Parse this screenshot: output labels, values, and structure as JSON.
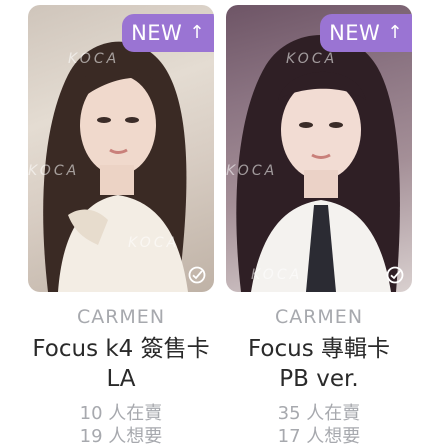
{
  "cards": [
    {
      "badge": "NEW",
      "badge_icon": "arrow-up-icon",
      "watermark": "KOCA",
      "artist": "CARMEN",
      "title": "Focus k4 簽售卡 LA",
      "selling": "10 人在賣",
      "wanting": "19 人想要"
    },
    {
      "badge": "NEW",
      "badge_icon": "arrow-up-icon",
      "watermark": "KOCA",
      "artist": "CARMEN",
      "title": "Focus 專輯卡 PB ver.",
      "selling": "35 人在賣",
      "wanting": "17 人想要"
    }
  ],
  "colors": {
    "badge": "#9a74d3",
    "muted_text": "#a7a9ae",
    "title_text": "#2a2a2a"
  }
}
